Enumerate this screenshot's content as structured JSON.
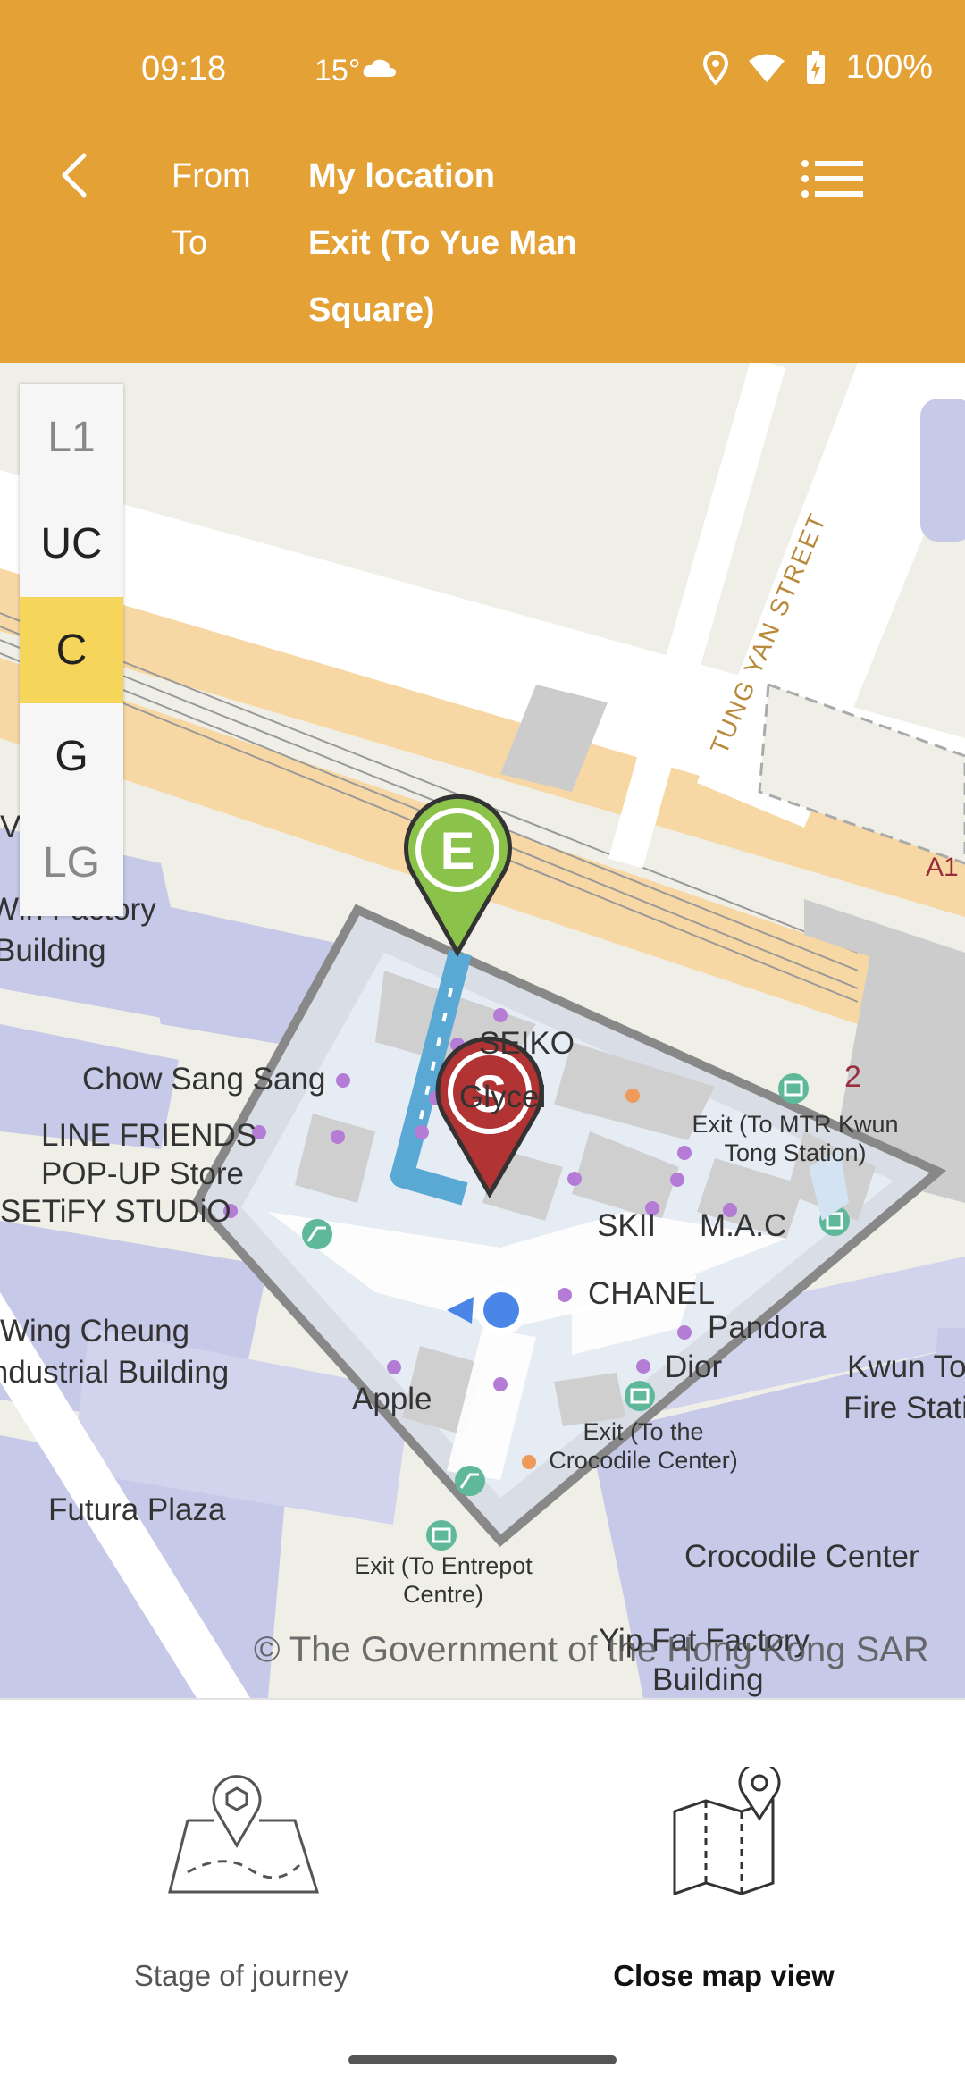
{
  "status_bar": {
    "time": "09:18",
    "temperature": "15°",
    "battery": "100%"
  },
  "header": {
    "from_label": "From",
    "from_value": "My location",
    "to_label": "To",
    "to_value": "Exit (To Yue Man Square)"
  },
  "floor_selector": {
    "floors": [
      "L1",
      "UC",
      "C",
      "G",
      "LG"
    ],
    "selected": "C"
  },
  "map": {
    "street_label": "TUNG YAN STREET",
    "route_label": "A1",
    "level_marker": "2",
    "start_marker": "S",
    "end_marker": "E",
    "labels": {
      "view": "View",
      "factory1": "Win Factory",
      "factory2": "Building",
      "chow": "Chow Sang Sang",
      "seiko": "SEIKO",
      "glycel": "Glycel",
      "linefriends1": "LINE FRIENDS",
      "linefriends2": "POP-UP Store",
      "setify": "SETiFY STUDiO",
      "skii": "SKII",
      "mac": "M.A.C",
      "chanel": "CHANEL",
      "pandora": "Pandora",
      "dior": "Dior",
      "apple": "Apple",
      "wingcheung1": "Wing Cheung",
      "wingcheung2": "Industrial Building",
      "futura": "Futura Plaza",
      "crocodile": "Crocodile Center",
      "kwuntong1": "Kwun Tong",
      "kwuntong2": "Fire Station",
      "yipfat1": "Yip Fat Factory",
      "yipfat2": "Building",
      "exit_mtr": "Exit (To MTR Kwun Tong Station)",
      "exit_croc": "Exit (To the Crocodile Center)",
      "exit_entrepot": "Exit (To Entrepot Centre)"
    },
    "copyright": "© The Government of the Hong Kong SAR"
  },
  "bottom_bar": {
    "stage_label": "Stage of journey",
    "close_label": "Close map view"
  },
  "colors": {
    "header": "#e4a136",
    "floor_active": "#f5d55a",
    "route": "#5aa8d4",
    "start_pin": "#b23333",
    "end_pin": "#8bc34a",
    "location_dot": "#4a86e8"
  }
}
